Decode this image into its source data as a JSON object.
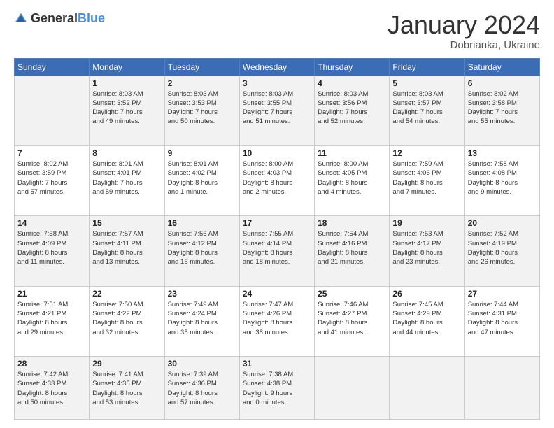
{
  "header": {
    "logo_general": "General",
    "logo_blue": "Blue",
    "month_year": "January 2024",
    "location": "Dobrianka, Ukraine"
  },
  "weekdays": [
    "Sunday",
    "Monday",
    "Tuesday",
    "Wednesday",
    "Thursday",
    "Friday",
    "Saturday"
  ],
  "weeks": [
    [
      {
        "day": "",
        "info": ""
      },
      {
        "day": "1",
        "info": "Sunrise: 8:03 AM\nSunset: 3:52 PM\nDaylight: 7 hours\nand 49 minutes."
      },
      {
        "day": "2",
        "info": "Sunrise: 8:03 AM\nSunset: 3:53 PM\nDaylight: 7 hours\nand 50 minutes."
      },
      {
        "day": "3",
        "info": "Sunrise: 8:03 AM\nSunset: 3:55 PM\nDaylight: 7 hours\nand 51 minutes."
      },
      {
        "day": "4",
        "info": "Sunrise: 8:03 AM\nSunset: 3:56 PM\nDaylight: 7 hours\nand 52 minutes."
      },
      {
        "day": "5",
        "info": "Sunrise: 8:03 AM\nSunset: 3:57 PM\nDaylight: 7 hours\nand 54 minutes."
      },
      {
        "day": "6",
        "info": "Sunrise: 8:02 AM\nSunset: 3:58 PM\nDaylight: 7 hours\nand 55 minutes."
      }
    ],
    [
      {
        "day": "7",
        "info": "Sunrise: 8:02 AM\nSunset: 3:59 PM\nDaylight: 7 hours\nand 57 minutes."
      },
      {
        "day": "8",
        "info": "Sunrise: 8:01 AM\nSunset: 4:01 PM\nDaylight: 7 hours\nand 59 minutes."
      },
      {
        "day": "9",
        "info": "Sunrise: 8:01 AM\nSunset: 4:02 PM\nDaylight: 8 hours\nand 1 minute."
      },
      {
        "day": "10",
        "info": "Sunrise: 8:00 AM\nSunset: 4:03 PM\nDaylight: 8 hours\nand 2 minutes."
      },
      {
        "day": "11",
        "info": "Sunrise: 8:00 AM\nSunset: 4:05 PM\nDaylight: 8 hours\nand 4 minutes."
      },
      {
        "day": "12",
        "info": "Sunrise: 7:59 AM\nSunset: 4:06 PM\nDaylight: 8 hours\nand 7 minutes."
      },
      {
        "day": "13",
        "info": "Sunrise: 7:58 AM\nSunset: 4:08 PM\nDaylight: 8 hours\nand 9 minutes."
      }
    ],
    [
      {
        "day": "14",
        "info": "Sunrise: 7:58 AM\nSunset: 4:09 PM\nDaylight: 8 hours\nand 11 minutes."
      },
      {
        "day": "15",
        "info": "Sunrise: 7:57 AM\nSunset: 4:11 PM\nDaylight: 8 hours\nand 13 minutes."
      },
      {
        "day": "16",
        "info": "Sunrise: 7:56 AM\nSunset: 4:12 PM\nDaylight: 8 hours\nand 16 minutes."
      },
      {
        "day": "17",
        "info": "Sunrise: 7:55 AM\nSunset: 4:14 PM\nDaylight: 8 hours\nand 18 minutes."
      },
      {
        "day": "18",
        "info": "Sunrise: 7:54 AM\nSunset: 4:16 PM\nDaylight: 8 hours\nand 21 minutes."
      },
      {
        "day": "19",
        "info": "Sunrise: 7:53 AM\nSunset: 4:17 PM\nDaylight: 8 hours\nand 23 minutes."
      },
      {
        "day": "20",
        "info": "Sunrise: 7:52 AM\nSunset: 4:19 PM\nDaylight: 8 hours\nand 26 minutes."
      }
    ],
    [
      {
        "day": "21",
        "info": "Sunrise: 7:51 AM\nSunset: 4:21 PM\nDaylight: 8 hours\nand 29 minutes."
      },
      {
        "day": "22",
        "info": "Sunrise: 7:50 AM\nSunset: 4:22 PM\nDaylight: 8 hours\nand 32 minutes."
      },
      {
        "day": "23",
        "info": "Sunrise: 7:49 AM\nSunset: 4:24 PM\nDaylight: 8 hours\nand 35 minutes."
      },
      {
        "day": "24",
        "info": "Sunrise: 7:47 AM\nSunset: 4:26 PM\nDaylight: 8 hours\nand 38 minutes."
      },
      {
        "day": "25",
        "info": "Sunrise: 7:46 AM\nSunset: 4:27 PM\nDaylight: 8 hours\nand 41 minutes."
      },
      {
        "day": "26",
        "info": "Sunrise: 7:45 AM\nSunset: 4:29 PM\nDaylight: 8 hours\nand 44 minutes."
      },
      {
        "day": "27",
        "info": "Sunrise: 7:44 AM\nSunset: 4:31 PM\nDaylight: 8 hours\nand 47 minutes."
      }
    ],
    [
      {
        "day": "28",
        "info": "Sunrise: 7:42 AM\nSunset: 4:33 PM\nDaylight: 8 hours\nand 50 minutes."
      },
      {
        "day": "29",
        "info": "Sunrise: 7:41 AM\nSunset: 4:35 PM\nDaylight: 8 hours\nand 53 minutes."
      },
      {
        "day": "30",
        "info": "Sunrise: 7:39 AM\nSunset: 4:36 PM\nDaylight: 8 hours\nand 57 minutes."
      },
      {
        "day": "31",
        "info": "Sunrise: 7:38 AM\nSunset: 4:38 PM\nDaylight: 9 hours\nand 0 minutes."
      },
      {
        "day": "",
        "info": ""
      },
      {
        "day": "",
        "info": ""
      },
      {
        "day": "",
        "info": ""
      }
    ]
  ]
}
